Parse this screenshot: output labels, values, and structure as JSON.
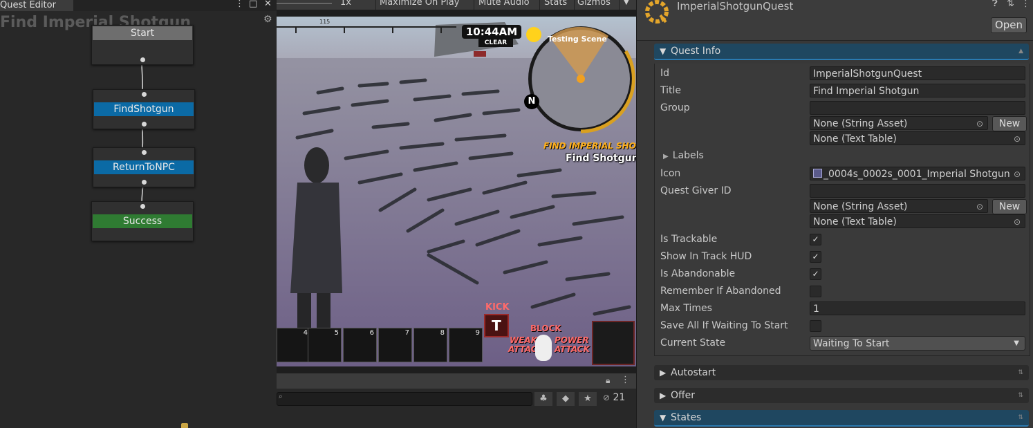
{
  "quest_editor": {
    "tab": "Quest Editor",
    "title": "Find Imperial Shotgun",
    "nodes": [
      {
        "label": "Start",
        "color": "#6e6e6e"
      },
      {
        "label": "FindShotgun",
        "color": "#0b6aa5"
      },
      {
        "label": "ReturnToNPC",
        "color": "#0b6aa5"
      },
      {
        "label": "Success",
        "color": "#2f7b32"
      }
    ]
  },
  "game_toolbar": {
    "scale_value": "1x",
    "maximize_label": "Maximize On Play",
    "mute_label": "Mute Audio",
    "stats_label": "Stats",
    "gizmos_label": "Gizmos"
  },
  "game_hud": {
    "compass_value": "115",
    "time": "10:44AM",
    "weather": "CLEAR",
    "minimap_label": "Testing Scene",
    "north": "N",
    "quest_title": "FIND IMPERIAL SHOTGUN",
    "quest_task": "Find Shotgun",
    "hotbar": [
      "4",
      "5",
      "6",
      "7",
      "8",
      "9"
    ],
    "kick_label": "KICK",
    "kick_key": "T",
    "block_label": "BLOCK",
    "weak_attack": "WEAK ATTACK",
    "power_attack": "POWER ATTACK"
  },
  "game_bottom": {
    "hidden_count": "21"
  },
  "inspector": {
    "title": "ImperialShotgunQuest",
    "open_label": "Open",
    "quest_info_label": "Quest Info",
    "fields": {
      "id_label": "Id",
      "id_value": "ImperialShotgunQuest",
      "title_label": "Title",
      "title_value": "Find Imperial Shotgun",
      "group_label": "Group",
      "group_value": "",
      "group_string_asset": "None (String Asset)",
      "group_text_table": "None (Text Table)",
      "new_label": "New",
      "labels_label": "Labels",
      "icon_label": "Icon",
      "icon_value": "_0004s_0002s_0001_Imperial Shotgun",
      "quest_giver_label": "Quest Giver ID",
      "quest_giver_value": "",
      "giver_string_asset": "None (String Asset)",
      "giver_text_table": "None (Text Table)",
      "is_trackable_label": "Is Trackable",
      "is_trackable": true,
      "show_hud_label": "Show In Track HUD",
      "show_hud": true,
      "is_abandonable_label": "Is Abandonable",
      "is_abandonable": true,
      "remember_label": "Remember If Abandoned",
      "remember": false,
      "max_times_label": "Max Times",
      "max_times_value": "1",
      "save_all_label": "Save All If Waiting To Start",
      "save_all": false,
      "current_state_label": "Current State",
      "current_state_value": "Waiting To Start"
    },
    "autostart_label": "Autostart",
    "offer_label": "Offer",
    "states_label": "States"
  }
}
